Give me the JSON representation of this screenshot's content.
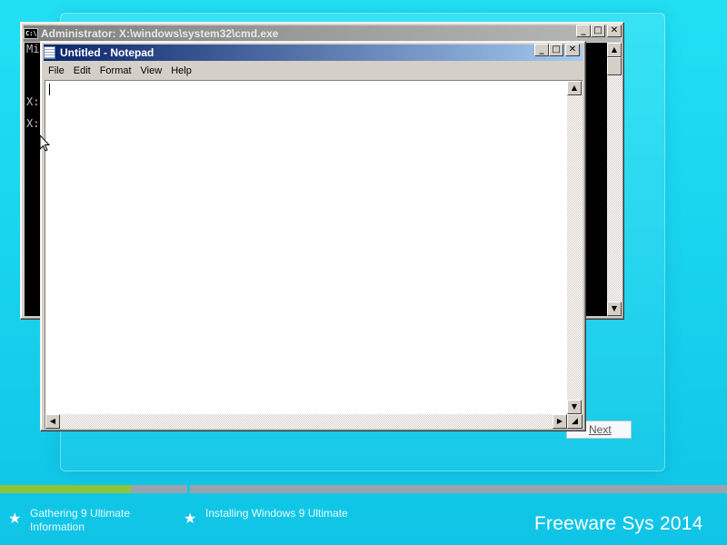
{
  "setup": {
    "next_label": "Next"
  },
  "cmd": {
    "title": "Administrator: X:\\windows\\system32\\cmd.exe",
    "icon_label": "C:\\",
    "lines": [
      "Mi",
      "X:",
      "X:"
    ]
  },
  "notepad": {
    "title": "Untitled - Notepad",
    "menu": [
      "File",
      "Edit",
      "Format",
      "View",
      "Help"
    ],
    "text": ""
  },
  "window_controls": {
    "minimize": "_",
    "maximize": "□",
    "close": "✕"
  },
  "progress": {
    "steps": [
      {
        "label_line1": "Gathering 9 Ultimate",
        "label_line2": "Information",
        "progress": 0.7
      },
      {
        "label_line1": "Installing Windows 9 Ultimate",
        "label_line2": "",
        "progress": 0.0
      }
    ]
  },
  "brand": "Freeware Sys 2014",
  "colors": {
    "background": "#1fd6f0",
    "progress_done": "#8fc33a",
    "progress_track": "#9aa3ab",
    "notepad_titlebar": "#0a246a",
    "cmd_titlebar_inactive": "#808080"
  }
}
